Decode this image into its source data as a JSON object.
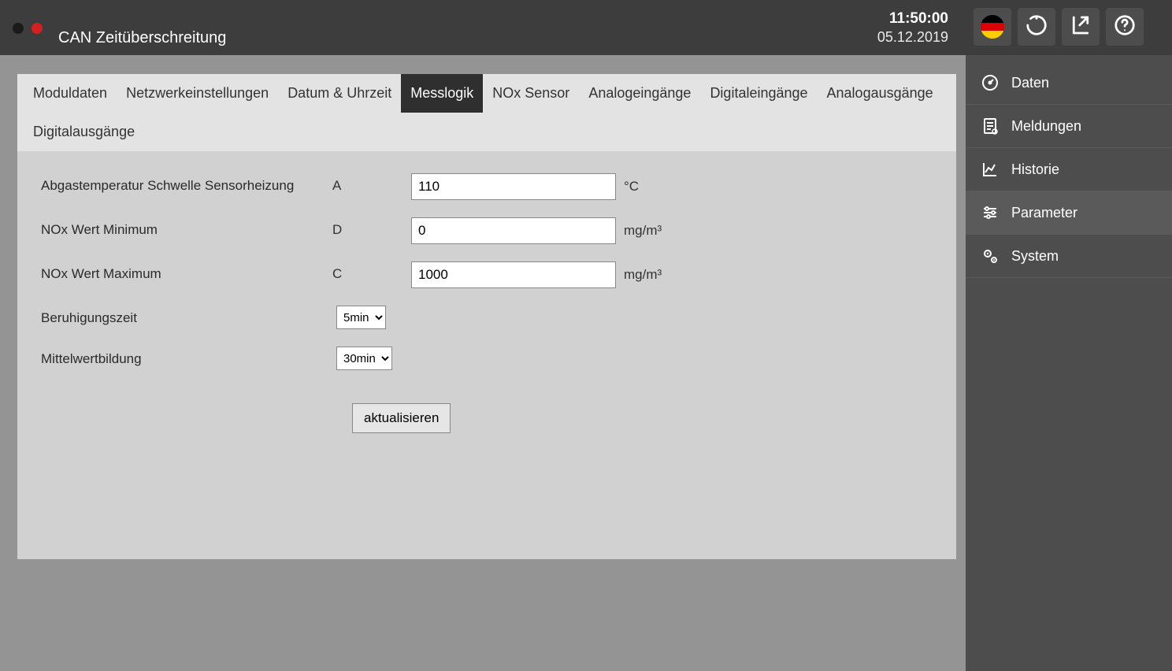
{
  "header": {
    "page_title": "CAN Zeitüberschreitung",
    "time": "11:50:00",
    "date": "05.12.2019"
  },
  "top_buttons": {
    "language": "language-de",
    "refresh": "refresh",
    "export": "export",
    "help": "help"
  },
  "tabs": [
    {
      "id": "moduldaten",
      "label": "Moduldaten",
      "active": false
    },
    {
      "id": "netzwerk",
      "label": "Netzwerkeinstellungen",
      "active": false
    },
    {
      "id": "datumuhrzeit",
      "label": "Datum & Uhrzeit",
      "active": false
    },
    {
      "id": "messlogik",
      "label": "Messlogik",
      "active": true
    },
    {
      "id": "noxsensor",
      "label": "NOx Sensor",
      "active": false
    },
    {
      "id": "analogeing",
      "label": "Analogeingänge",
      "active": false
    },
    {
      "id": "digitaleing",
      "label": "Digitaleingänge",
      "active": false
    },
    {
      "id": "analogausg",
      "label": "Analogausgänge",
      "active": false
    },
    {
      "id": "digitalausg",
      "label": "Digitalausgänge",
      "active": false
    }
  ],
  "form": {
    "row1": {
      "label": "Abgastemperatur Schwelle Sensorheizung",
      "code": "A",
      "value": "110",
      "unit": "°C"
    },
    "row2": {
      "label": "NOx Wert Minimum",
      "code": "D",
      "value": "0",
      "unit": "mg/m³"
    },
    "row3": {
      "label": "NOx Wert Maximum",
      "code": "C",
      "value": "1000",
      "unit": "mg/m³"
    },
    "row4": {
      "label": "Beruhigungszeit",
      "value": "5min"
    },
    "row5": {
      "label": "Mittelwertbildung",
      "value": "30min"
    },
    "update_label": "aktualisieren"
  },
  "sidebar": {
    "items": [
      {
        "id": "daten",
        "label": "Daten",
        "icon": "gauge-icon",
        "active": false
      },
      {
        "id": "meldungen",
        "label": "Meldungen",
        "icon": "report-icon",
        "active": false
      },
      {
        "id": "historie",
        "label": "Historie",
        "icon": "chart-icon",
        "active": false
      },
      {
        "id": "parameter",
        "label": "Parameter",
        "icon": "sliders-icon",
        "active": true
      },
      {
        "id": "system",
        "label": "System",
        "icon": "gears-icon",
        "active": false
      }
    ]
  }
}
